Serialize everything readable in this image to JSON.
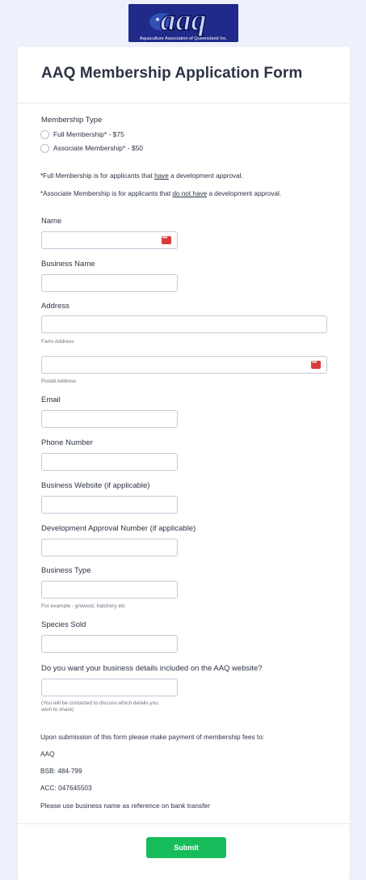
{
  "logo": {
    "text": "aaq",
    "subtitle": "Aquaculture Association of Queensland Inc."
  },
  "form": {
    "title": "AAQ Membership Application Form",
    "membership": {
      "label": "Membership Type",
      "options": [
        "Full Membership* - $75",
        "Associate Membership* - $50"
      ]
    },
    "notes": {
      "full_prefix": "*Full Membership is for applicants that ",
      "full_underline": "have",
      "full_suffix": " a development approval.",
      "assoc_prefix": "*Associate Membership is for applicants that ",
      "assoc_underline": "do not have",
      "assoc_suffix": " a development approval."
    },
    "fields": {
      "name": "Name",
      "business_name": "Business Name",
      "address": "Address",
      "farm_address": "Farm Address",
      "postal_address": "Postal Address",
      "email": "Email",
      "phone": "Phone Number",
      "website": "Business Website (if applicable)",
      "approval": "Development Approval Number (if applicable)",
      "business_type": "Business Type",
      "business_type_hint": "For example - growout, hatchery etc",
      "species": "Species Sold",
      "details_question": "Do you want your business details included on the AAQ website?",
      "details_hint_1": "(You will be contacted to discuss which details you",
      "details_hint_2": "wish to share)"
    },
    "payment": {
      "intro": "Upon submission of this form please make payment of membership fees to:",
      "name": "AAQ",
      "bsb": "BSB: 484-799",
      "acc": "ACC: 047645503",
      "reference": "Please use business name as reference on bank transfer"
    },
    "submit_label": "Submit"
  },
  "colors": {
    "background": "#eef0fb",
    "submit": "#18bd5b",
    "logo": "#1f2a8a"
  }
}
